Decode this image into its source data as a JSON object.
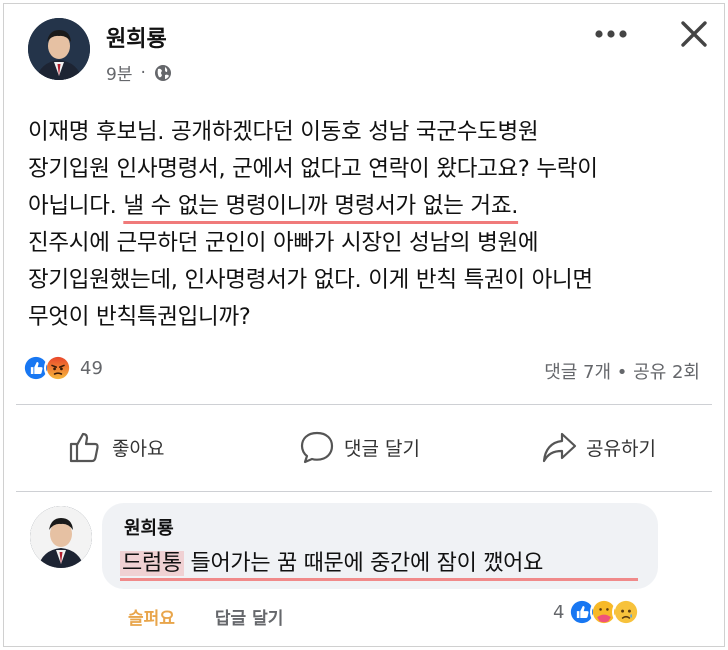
{
  "post": {
    "author": "원희룡",
    "time": "9분",
    "separator": "·",
    "text_lines": [
      "이재명 후보님. 공개하겠다던 이동호 성남 국군수도병원",
      "장기입원 인사명령서, 군에서 없다고 연락이 왔다고요? 누락이",
      "아닙니다. ",
      "진주시에 근무하던 군인이 아빠가 시장인 성남의 병원에",
      "장기입원했는데, 인사명령서가 없다. 이게 반칙 특권이 아니면",
      "무엇이 반칙특권입니까?"
    ],
    "highlight": "낼 수 없는 명령이니까 명령서가 없는 거죠.",
    "reaction_count": "49",
    "stats": "댓글 7개 • 공유 2회"
  },
  "actions": {
    "like": "좋아요",
    "comment": "댓글 달기",
    "share": "공유하기"
  },
  "comment": {
    "author": "원희룡",
    "highlight": "드럼통",
    "text": " 들어가는 꿈 때문에 중간에 잠이 깼어요",
    "action_reaction": "슬퍼요",
    "action_reply": "답글 달기",
    "reaction_count": "4"
  },
  "colors": {
    "like_blue": "#1877f2",
    "angry_orange": "#f0622a",
    "care_yellow": "#f7b928",
    "underline_pink": "#f07a7a",
    "muted": "#65676b"
  },
  "icons": [
    "avatar",
    "globe-icon",
    "more-icon",
    "close-icon",
    "like-reaction-icon",
    "angry-reaction-icon",
    "thumbs-up-icon",
    "comment-icon",
    "share-icon",
    "care-reaction-icon",
    "sad-reaction-icon"
  ]
}
